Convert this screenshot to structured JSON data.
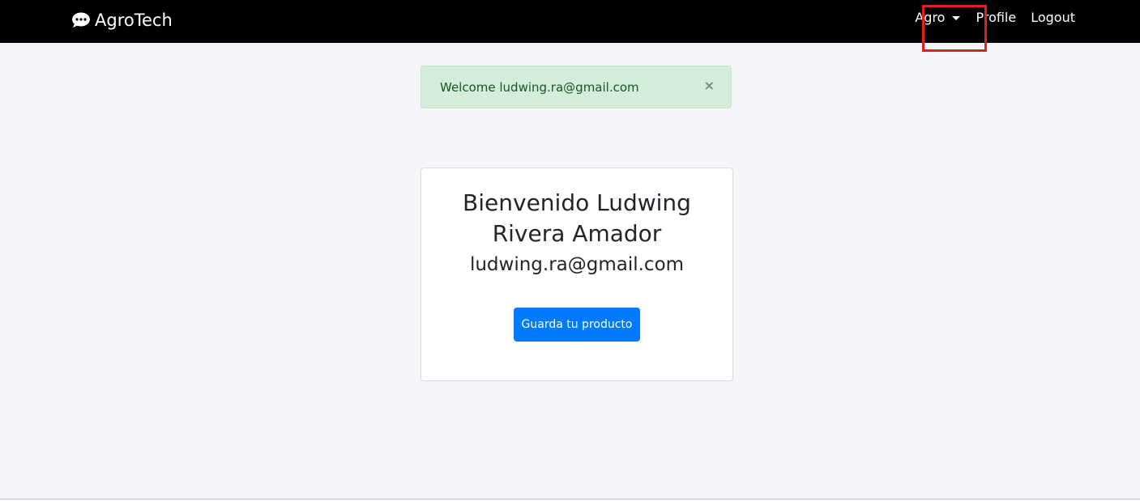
{
  "navbar": {
    "brand": {
      "icon": "comment-dots-icon",
      "label": "AgroTech"
    },
    "items": {
      "agro": {
        "label": "Agro",
        "icon": "caret-down-icon"
      },
      "profile": {
        "label": "Profile"
      },
      "logout": {
        "label": "Logout"
      }
    }
  },
  "alert": {
    "message": "Welcome ludwing.ra@gmail.com",
    "close_label": "×"
  },
  "card": {
    "title": "Bienvenido Ludwing Rivera Amador",
    "email": "ludwing.ra@gmail.com",
    "button_label": "Guarda tu producto"
  },
  "colors": {
    "navbar_bg": "#000000",
    "page_bg": "#f4f5f9",
    "alert_bg": "#d4edda",
    "alert_text": "#155724",
    "primary": "#007bff",
    "highlight": "#e02020"
  }
}
